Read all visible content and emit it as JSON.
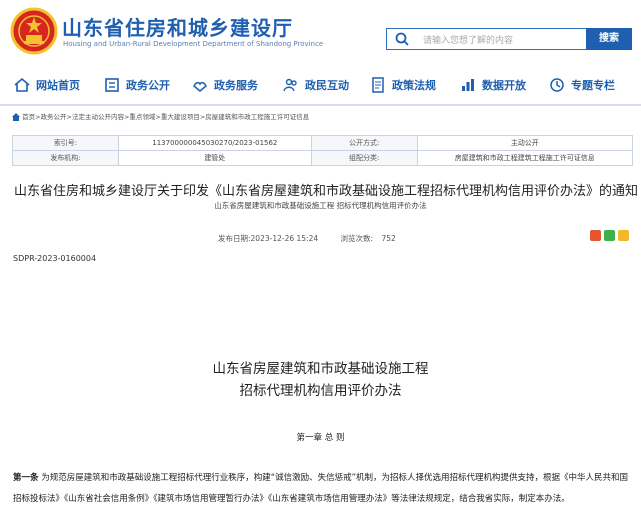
{
  "header": {
    "title": "山东省住房和城乡建设厅",
    "subtitle": "Housing and Urban-Rural Development Department of Shandong Province",
    "search_placeholder": "请输入您想了解的内容",
    "search_button": "搜索"
  },
  "nav": [
    {
      "label": "网站首页",
      "icon": "home-icon"
    },
    {
      "label": "政务公开",
      "icon": "list-icon"
    },
    {
      "label": "政务服务",
      "icon": "service-icon"
    },
    {
      "label": "政民互动",
      "icon": "interaction-icon"
    },
    {
      "label": "政策法规",
      "icon": "policy-icon"
    },
    {
      "label": "数据开放",
      "icon": "data-icon"
    },
    {
      "label": "专题专栏",
      "icon": "topic-icon"
    }
  ],
  "breadcrumb": "首页>政务公开>法定主动公开内容>重点领域>重大建设项目>房屋建筑和市政工程施工许可证信息",
  "meta": {
    "index_label": "索引号:",
    "index_value": "11370000004503027​0/2023-01562",
    "public_label": "公开方式:",
    "public_value": "主动公开",
    "org_label": "发布机构:",
    "org_value": "建管处",
    "cat_label": "组配分类:",
    "cat_value": "房屋建筑和市政工程建筑工程施工许可证信息"
  },
  "doc": {
    "title": "山东省住房和城乡建设厅关于印发《山东省房屋建筑和市政基础设施工程招标代理机构信用评价办法》的通知",
    "subtitle": "山东省房屋建筑和市政基础设施工程 招标代理机构信用评价办法",
    "publish_time": "发布日期:2023-12-26 15:24",
    "views_label": "浏览次数:",
    "views": "752",
    "doc_number": "SDPR-2023-0160004",
    "article_title_line1": "山东省房屋建筑和市政基础设施工程",
    "article_title_line2": "招标代理机构信用评价办法",
    "chapter": "第一章 总 则",
    "article_label": "第一条",
    "article_text": "为规范房屋建筑和市政基础设施工程招标代理行业秩序，构建“诚信激励、失信惩戒”机制，为招标人择优选用招标代理机构提供支持，根据《中华人民共和国招标投标法》《山东省社会信用条例》《建筑市场信用管理暂行办法》《山东省建筑市场信用管理办法》等法律法规规定，结合我省实际，制定本办法。"
  },
  "colors": {
    "brand": "#1f5fb0",
    "emblem_red": "#d7261e",
    "emblem_gold": "#f2c230"
  }
}
